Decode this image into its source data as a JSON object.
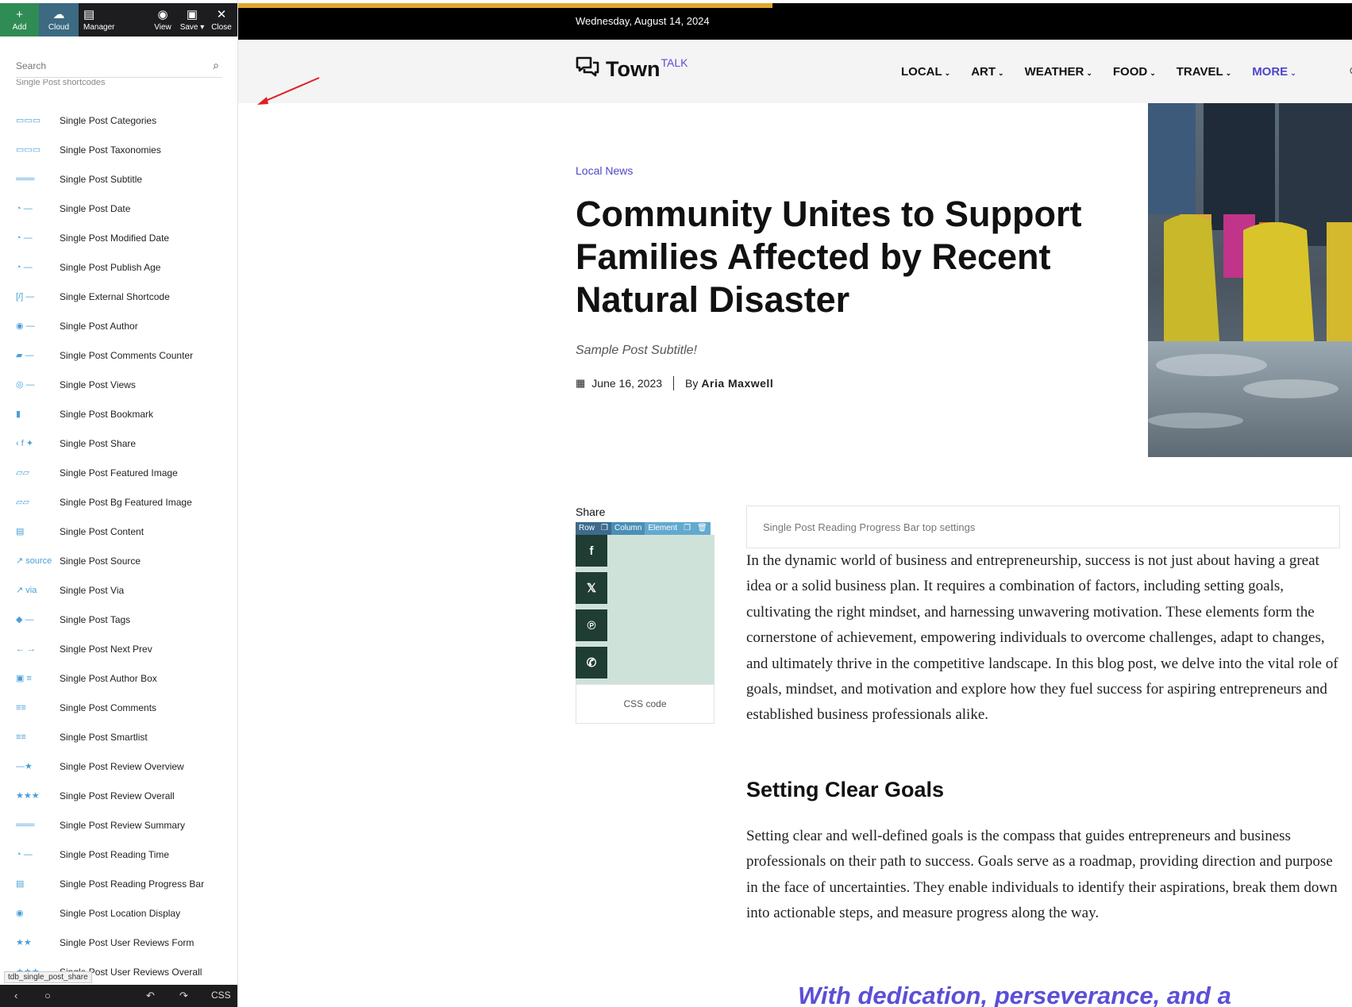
{
  "toolbar": {
    "add": "Add",
    "cloud": "Cloud",
    "manager": "Manager",
    "view": "View",
    "save": "Save",
    "close": "Close"
  },
  "panel": {
    "search_placeholder": "Search",
    "section_label": "Single Post shortcodes",
    "items": [
      {
        "label": "Single Post Categories",
        "icon": "categories-icon"
      },
      {
        "label": "Single Post Taxonomies",
        "icon": "taxonomies-icon"
      },
      {
        "label": "Single Post Subtitle",
        "icon": "subtitle-icon"
      },
      {
        "label": "Single Post Date",
        "icon": "date-icon"
      },
      {
        "label": "Single Post Modified Date",
        "icon": "modified-date-icon"
      },
      {
        "label": "Single Post Publish Age",
        "icon": "publish-age-icon"
      },
      {
        "label": "Single External Shortcode",
        "icon": "shortcode-icon"
      },
      {
        "label": "Single Post Author",
        "icon": "author-icon"
      },
      {
        "label": "Single Post Comments Counter",
        "icon": "comments-counter-icon"
      },
      {
        "label": "Single Post Views",
        "icon": "views-icon"
      },
      {
        "label": "Single Post Bookmark",
        "icon": "bookmark-icon"
      },
      {
        "label": "Single Post Share",
        "icon": "share-icon"
      },
      {
        "label": "Single Post Featured Image",
        "icon": "featured-image-icon"
      },
      {
        "label": "Single Post Bg Featured Image",
        "icon": "bg-featured-image-icon"
      },
      {
        "label": "Single Post Content",
        "icon": "content-icon"
      },
      {
        "label": "Single Post Source",
        "icon": "source-icon"
      },
      {
        "label": "Single Post Via",
        "icon": "via-icon"
      },
      {
        "label": "Single Post Tags",
        "icon": "tags-icon"
      },
      {
        "label": "Single Post Next Prev",
        "icon": "next-prev-icon"
      },
      {
        "label": "Single Post Author Box",
        "icon": "author-box-icon"
      },
      {
        "label": "Single Post Comments",
        "icon": "comments-icon"
      },
      {
        "label": "Single Post Smartlist",
        "icon": "smartlist-icon"
      },
      {
        "label": "Single Post Review Overview",
        "icon": "review-overview-icon"
      },
      {
        "label": "Single Post Review Overall",
        "icon": "review-overall-icon"
      },
      {
        "label": "Single Post Review Summary",
        "icon": "review-summary-icon"
      },
      {
        "label": "Single Post Reading Time",
        "icon": "reading-time-icon"
      },
      {
        "label": "Single Post Reading Progress Bar",
        "icon": "reading-progress-icon"
      },
      {
        "label": "Single Post Location Display",
        "icon": "location-icon"
      },
      {
        "label": "Single Post User Reviews Form",
        "icon": "user-reviews-form-icon"
      },
      {
        "label": "Single Post User Reviews Overall",
        "icon": "user-reviews-overall-icon"
      }
    ],
    "tooltip": "tdb_single_post_share",
    "bottom_css": "CSS"
  },
  "site": {
    "date": "Wednesday, August 14, 2024",
    "logo_main": "Town",
    "logo_sup": "TALK",
    "nav": [
      {
        "label": "LOCAL"
      },
      {
        "label": "ART"
      },
      {
        "label": "WEATHER"
      },
      {
        "label": "FOOD"
      },
      {
        "label": "TRAVEL"
      },
      {
        "label": "MORE"
      }
    ]
  },
  "post": {
    "category": "Local News",
    "title": "Community Unites to Support Families Affected by Recent Natural Disaster",
    "subtitle": "Sample Post Subtitle!",
    "date": "June 16, 2023",
    "by": "By",
    "author": "Aria Maxwell",
    "share_label": "Share",
    "share_tools": {
      "row": "Row",
      "column": "Column",
      "element": "Element"
    },
    "css_code": "CSS code",
    "reading_bar_settings": "Single Post Reading Progress Bar top settings",
    "p1": "In the dynamic world of business and entrepreneurship, success is not just about having a great idea or a solid business plan. It requires a combination of factors, including setting goals, cultivating the right mindset, and harnessing unwavering motivation. These elements form the cornerstone of achievement, empowering individuals to overcome challenges, adapt to changes, and ultimately thrive in the competitive landscape. In this blog post, we delve into the vital role of goals, mindset, and motivation and explore how they fuel success for aspiring entrepreneurs and established business professionals alike.",
    "h2": "Setting Clear Goals",
    "p2": "Setting clear and well-defined goals is the compass that guides entrepreneurs and business professionals on their path to success. Goals serve as a roadmap, providing direction and purpose in the face of uncertainties. They enable individuals to identify their aspirations, break them down into actionable steps, and measure progress along the way.",
    "quote": "With dedication, perseverance, and a"
  },
  "colors": {
    "accent": "#4e46c9",
    "progress": "#e0a72c",
    "share_btn": "#1f3d33",
    "share_bg": "#cfe2d9",
    "panel_icon": "#4a9fd8"
  }
}
